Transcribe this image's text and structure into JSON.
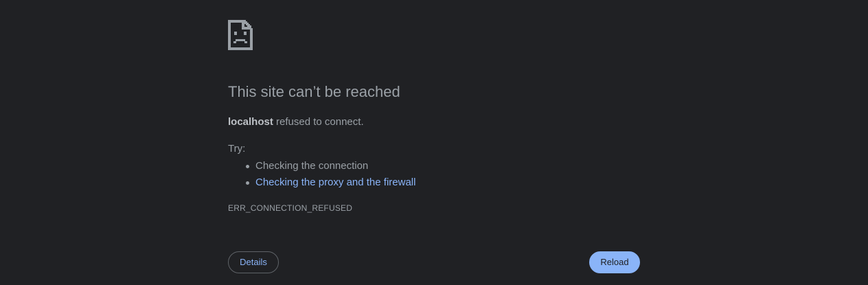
{
  "icon": "sad-document-icon",
  "title": "This site can’t be reached",
  "summary": {
    "host": "localhost",
    "message": " refused to connect."
  },
  "try_label": "Try:",
  "suggestions": [
    {
      "text": "Checking the connection",
      "link": false
    },
    {
      "text": "Checking the proxy and the firewall",
      "link": true
    }
  ],
  "error_code": "ERR_CONNECTION_REFUSED",
  "buttons": {
    "details": "Details",
    "reload": "Reload"
  },
  "colors": {
    "background": "#202124",
    "text": "#9aa0a6",
    "link": "#8ab4f8",
    "reload_button": "#8ab4f8"
  }
}
